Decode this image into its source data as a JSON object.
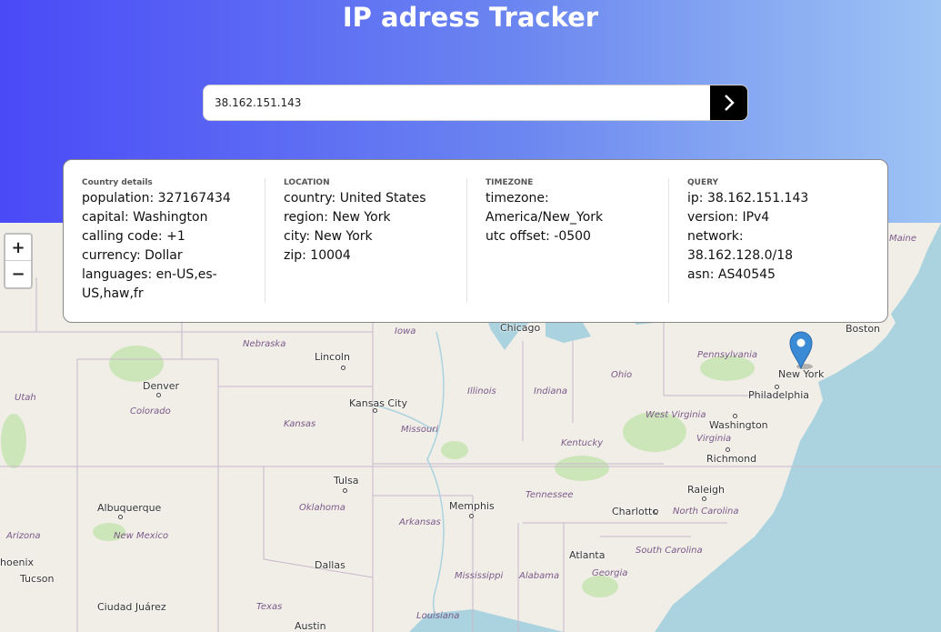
{
  "header": {
    "title": "IP adress Tracker",
    "search_value": "38.162.151.143"
  },
  "card": {
    "country": {
      "heading": "Country details",
      "lines": [
        "population: 327167434",
        "capital: Washington",
        "calling code: +1",
        "currency: Dollar",
        "languages: en-US,es-US,haw,fr"
      ]
    },
    "location": {
      "heading": "LOCATION",
      "lines": [
        "country: United States",
        "region: New York",
        "city: New York",
        "zip: 10004"
      ]
    },
    "timezone": {
      "heading": "TIMEZONE",
      "lines": [
        "timezone: America/New_York",
        "utc offset: -0500"
      ]
    },
    "query": {
      "heading": "QUERY",
      "lines": [
        "ip: 38.162.151.143",
        "version: IPv4",
        "network: 38.162.128.0/18",
        "asn: AS40545"
      ]
    }
  },
  "map": {
    "zoom_in": "+",
    "zoom_out": "−",
    "cities": {
      "chicago": "Chicago",
      "lincoln": "Lincoln",
      "denver": "Denver",
      "kansas_city": "Kansas City",
      "tulsa": "Tulsa",
      "albuquerque": "Albuquerque",
      "memphis": "Memphis",
      "dallas": "Dallas",
      "tucson": "Tucson",
      "phoenix": "hoenix",
      "ciudad_juarez": "Ciudad Juárez",
      "austin": "Austin",
      "atlanta": "Atlanta",
      "charlotte": "Charlotte",
      "raleigh": "Raleigh",
      "richmond": "Richmond",
      "washington": "Washington",
      "philadelphia": "Philadelphia",
      "new_york": "New York",
      "boston": "Boston"
    },
    "states": {
      "nebraska": "Nebraska",
      "iowa": "Iowa",
      "illinois": "Illinois",
      "indiana": "Indiana",
      "ohio": "Ohio",
      "pennsylvania": "Pennsylvania",
      "maine": "Maine",
      "utah": "Utah",
      "colorado": "Colorado",
      "kansas": "Kansas",
      "missouri": "Missouri",
      "kentucky": "Kentucky",
      "west_virginia": "West Virginia",
      "virginia": "Virginia",
      "oklahoma": "Oklahoma",
      "arkansas": "Arkansas",
      "tennessee": "Tennessee",
      "new_mexico": "New Mexico",
      "arizona": "Arizona",
      "north_carolina": "North Carolina",
      "south_carolina": "South Carolina",
      "mississippi": "Mississippi",
      "alabama": "Alabama",
      "georgia": "Georgia",
      "texas": "Texas",
      "louisiana": "Louisiana"
    }
  },
  "colors": {
    "water": "#aad3df",
    "land": "#f1eee8",
    "forest": "#cde6b9",
    "border": "#b9a9c3"
  }
}
